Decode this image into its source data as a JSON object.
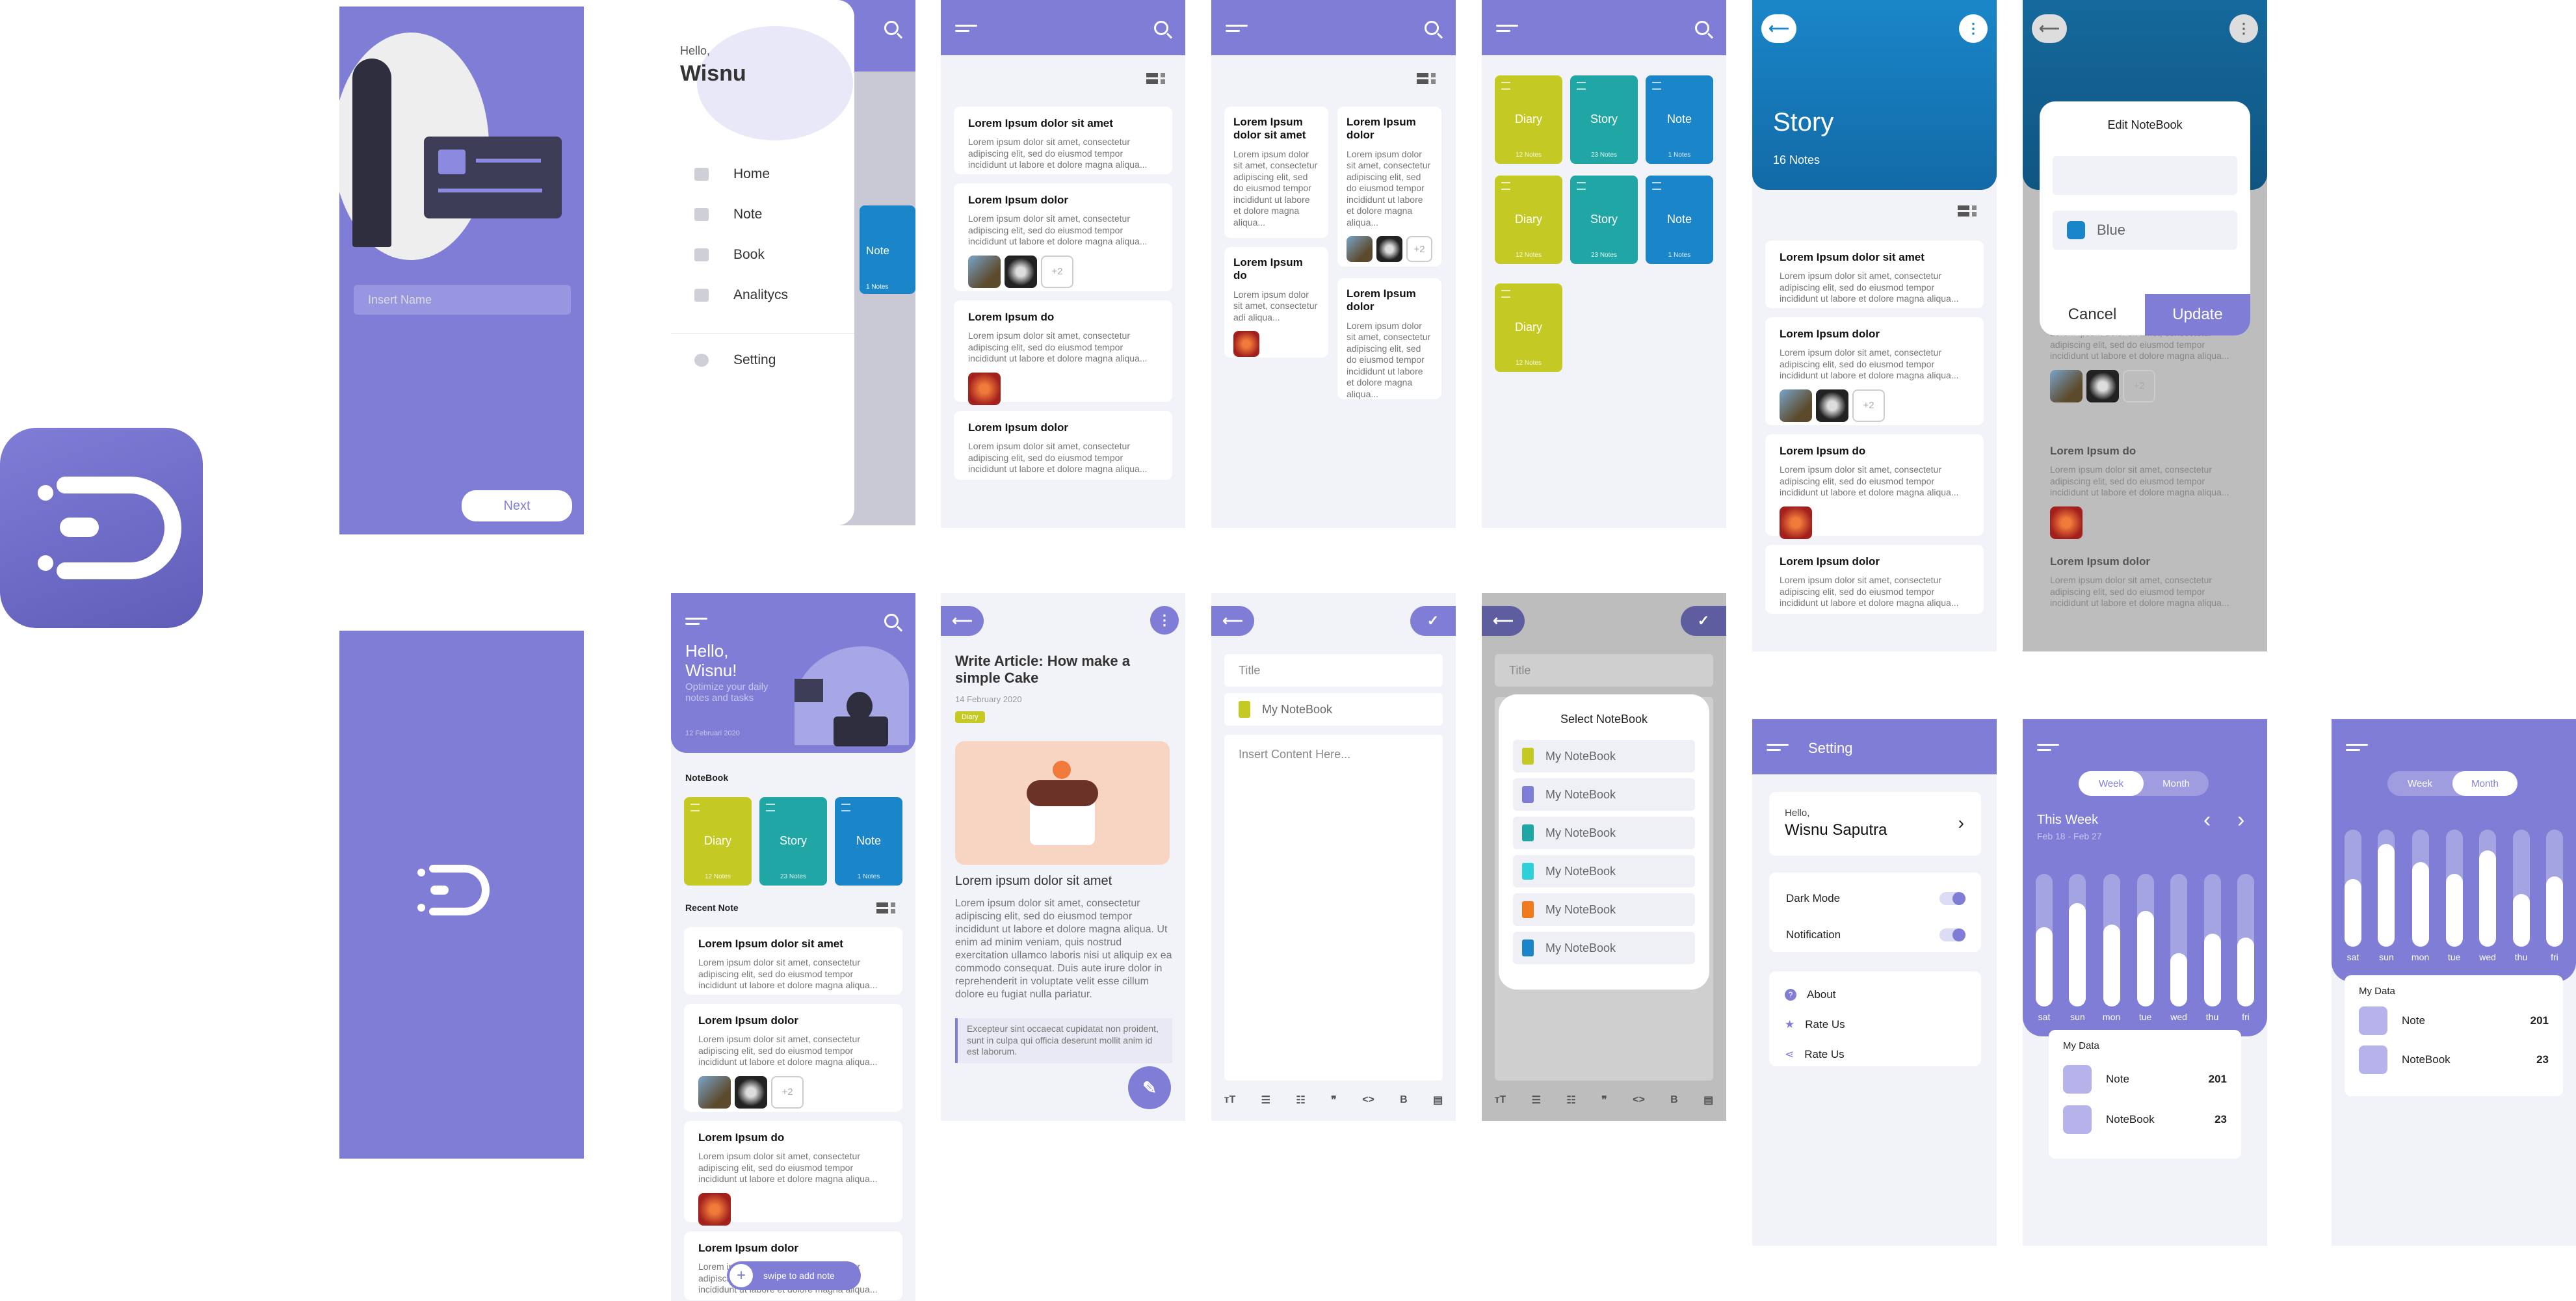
{
  "colors": {
    "primary": "#7f7dd6",
    "diary": "#c5c924",
    "story": "#20a6a4",
    "note": "#1a86c9",
    "bg": "#f2f3f8"
  },
  "onboarding": {
    "name_placeholder": "Insert Name",
    "next_label": "Next"
  },
  "drawer": {
    "hello": "Hello,",
    "name": "Wisnu",
    "items": [
      "Home",
      "Note",
      "Book",
      "Analitycs"
    ],
    "setting": "Setting",
    "peek_note": "Note",
    "peek_count": "1 Notes"
  },
  "notes": [
    {
      "title": "Lorem Ipsum dolor sit amet",
      "body": "Lorem ipsum dolor sit amet, consectetur adipiscing elit, sed do eiusmod tempor incididunt ut labore et dolore magna aliqua..."
    },
    {
      "title": "Lorem Ipsum dolor",
      "body": "Lorem ipsum dolor sit amet, consectetur adipiscing elit, sed do eiusmod tempor incididunt ut labore et dolore magna aliqua..."
    },
    {
      "title": "Lorem Ipsum do",
      "body": "Lorem ipsum dolor sit amet, consectetur adipiscing elit, sed do eiusmod tempor incididunt ut labore et dolore magna aliqua..."
    },
    {
      "title": "Lorem Ipsum dolor",
      "body": "Lorem ipsum dolor sit amet, consectetur adipiscing elit, sed do eiusmod tempor incididunt ut labore et dolore magna aliqua..."
    }
  ],
  "more_label": "+2",
  "grid_notes": [
    {
      "title": "Lorem Ipsum dolor sit amet",
      "body": "Lorem ipsum dolor sit amet, consectetur adipiscing elit, sed do eiusmod tempor incididunt ut labore et dolore magna aliqua..."
    },
    {
      "title": "Lorem Ipsum dolor",
      "body": "Lorem ipsum dolor sit amet, consectetur adipiscing elit, sed do eiusmod tempor incididunt ut labore et dolore magna aliqua..."
    },
    {
      "title": "Lorem Ipsum do",
      "body": "Lorem ipsum dolor sit amet, consectetur adi aliqua..."
    },
    {
      "title": "Lorem Ipsum dolor",
      "body": "Lorem ipsum dolor sit amet, consectetur adipiscing elit, sed do eiusmod tempor incididunt ut labore et dolore magna aliqua..."
    }
  ],
  "notebooks": [
    {
      "name": "Diary",
      "count": "12 Notes"
    },
    {
      "name": "Story",
      "count": "23 Notes"
    },
    {
      "name": "Note",
      "count": "1 Notes"
    }
  ],
  "story": {
    "title": "Story",
    "count": "16 Notes"
  },
  "edit_notebook": {
    "title": "Edit NoteBook",
    "color_label": "Blue",
    "cancel": "Cancel",
    "update": "Update"
  },
  "home": {
    "hello": "Hello,",
    "name": "Wisnu!",
    "subtitle": "Optimize your daily notes and tasks",
    "date": "12 Februari 2020",
    "notebook_heading": "NoteBook",
    "recent_heading": "Recent Note",
    "swipe_label": "swipe to add note"
  },
  "article": {
    "title": "Write Article: How make a simple Cake",
    "date": "14 February 2020",
    "tag": "Diary",
    "heading": "Lorem ipsum dolor sit amet",
    "body": "Lorem ipsum dolor sit amet, consectetur adipiscing elit, sed do eiusmod tempor incididunt ut labore et dolore magna aliqua. Ut enim ad minim veniam, quis nostrud exercitation ullamco laboris nisi ut aliquip ex ea commodo consequat. Duis aute irure dolor in reprehenderit in voluptate velit esse cillum dolore eu fugiat nulla pariatur.",
    "quote": "Excepteur sint occaecat cupidatat non proident, sunt in culpa qui officia deserunt mollit anim id est laborum."
  },
  "editor": {
    "title_placeholder": "Title",
    "notebook": "My NoteBook",
    "content_placeholder": "Insert Content Here...",
    "toolbar": [
      "тТ",
      "☰",
      "☷",
      "❞",
      "<>",
      "B",
      "▤"
    ]
  },
  "select_notebook": {
    "title_placeholder": "Title",
    "heading": "Select NoteBook",
    "items": [
      "My NoteBook",
      "My NoteBook",
      "My NoteBook",
      "My NoteBook",
      "My NoteBook",
      "My NoteBook"
    ],
    "item_colors": [
      "#c5c924",
      "#7f7dd6",
      "#20a6a4",
      "#2ed1d9",
      "#f07a1e",
      "#1a86c9"
    ]
  },
  "setting": {
    "title": "Setting",
    "hello": "Hello,",
    "name": "Wisnu Saputra",
    "dark_mode": "Dark Mode",
    "notification": "Notification",
    "about": "About",
    "rate1": "Rate Us",
    "rate2": "Rate Us"
  },
  "analytics_week": {
    "toggle": [
      "Week",
      "Month"
    ],
    "active": "Week",
    "heading": "This Week",
    "range": "Feb 18 - Feb 27",
    "days": [
      "sat",
      "sun",
      "mon",
      "tue",
      "wed",
      "thu",
      "fri"
    ],
    "values": [
      0.6,
      0.78,
      0.62,
      0.72,
      0.4,
      0.55,
      0.52
    ],
    "my_data": "My Data",
    "rows": [
      {
        "label": "Note",
        "value": "201"
      },
      {
        "label": "NoteBook",
        "value": "23"
      }
    ]
  },
  "analytics_month": {
    "toggle": [
      "Week",
      "Month"
    ],
    "active": "Month",
    "days": [
      "sat",
      "sun",
      "mon",
      "tue",
      "wed",
      "thu",
      "fri"
    ],
    "values": [
      0.58,
      0.88,
      0.72,
      0.62,
      0.82,
      0.45,
      0.6
    ],
    "my_data": "My Data",
    "rows": [
      {
        "label": "Note",
        "value": "201"
      },
      {
        "label": "NoteBook",
        "value": "23"
      }
    ]
  }
}
